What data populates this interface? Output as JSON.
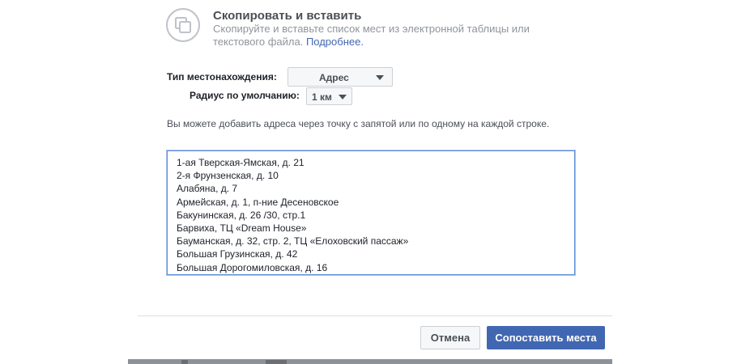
{
  "option": {
    "icon": "copy-icon",
    "title": "Скопировать и вставить",
    "description": "Скопируйте и вставьте список мест из электронной таблицы или текстового файла.",
    "more_link": "Подробнее."
  },
  "form": {
    "location_type_label": "Тип местонахождения:",
    "location_type_value": "Адрес",
    "radius_label": "Радиус по умолчанию:",
    "radius_value": "1 км",
    "hint": "Вы можете добавить адреса через точку с запятой или по одному на каждой строке."
  },
  "addresses": [
    "1-ая Тверская-Ямская, д. 21",
    "2-я Фрунзенская, д. 10",
    "Алабяна, д. 7",
    "Армейская, д. 1, п-ние Десеновское",
    "Бакунинская, д. 26 /30, стр.1",
    "Барвиха, ТЦ «Dream House»",
    "Бауманская, д. 32, стр. 2, ТЦ «Елоховский пассаж»",
    "Большая Грузинская, д. 42",
    "Большая Дорогомиловская, д. 16"
  ],
  "footer": {
    "cancel_label": "Отмена",
    "match_label": "Сопоставить места"
  },
  "colors": {
    "primary_button": "#4267b2",
    "focus_border": "#5d8ed9",
    "link": "#4267b2"
  }
}
